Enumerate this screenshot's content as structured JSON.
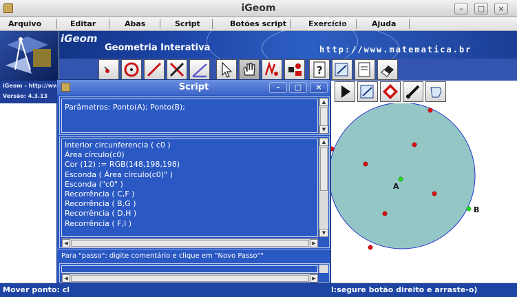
{
  "window": {
    "title": "iGeom"
  },
  "menubar": {
    "items": [
      "Arquivo",
      "Editar",
      "Abas",
      "Script",
      "Botões script",
      "Exercício",
      "Ajuda"
    ]
  },
  "banner": {
    "brand": "iGeom",
    "subtitle": "Geometria Interativa",
    "url": "http://www.matematica.br"
  },
  "info": {
    "site": "iGeom - http://ww",
    "version": "Versão: 4.3.13"
  },
  "toolbar": {
    "tools": [
      "point-icon",
      "circle-icon",
      "segment-icon",
      "intersection-icon",
      "angle-icon",
      "pointer-icon",
      "hand-icon",
      "edit-icon",
      "properties-icon",
      "help-icon",
      "script-icon",
      "script-run-icon",
      "eraser-icon"
    ],
    "script_tools": [
      "play-icon",
      "script-step-icon",
      "recurrence-icon",
      "brush-icon",
      "hand-script-icon"
    ]
  },
  "script_dialog": {
    "title": "Script",
    "parameters": "Parâmetros: Ponto(A); Ponto(B);",
    "lines": [
      "Interior circunferencia ( c0 )",
      "Área círculo(c0)",
      "Cor (12) := RGB(148,198,198)",
      "Esconda ( Área círculo(c0)\" )",
      "Esconda (\"c0\" )",
      "Recorrência ( C,F )",
      "Recorrência ( B,G )",
      "Recorrência ( D,H )",
      "Recorrência ( F,I )"
    ],
    "hint": "Para \"passo\": digite comentário e clique em \"Novo Passo\"\""
  },
  "canvas": {
    "circle_fill": "#94c6c6",
    "circle_stroke": "#2233cc",
    "label_a": "A",
    "label_b": "B"
  },
  "status": {
    "left": "Mover ponto: cl",
    "right": "l:segure botão direito e arraste-o)"
  },
  "colors": {
    "accent": "#2b59c3",
    "banner": "#1d46a8",
    "status": "#1e44a4"
  }
}
